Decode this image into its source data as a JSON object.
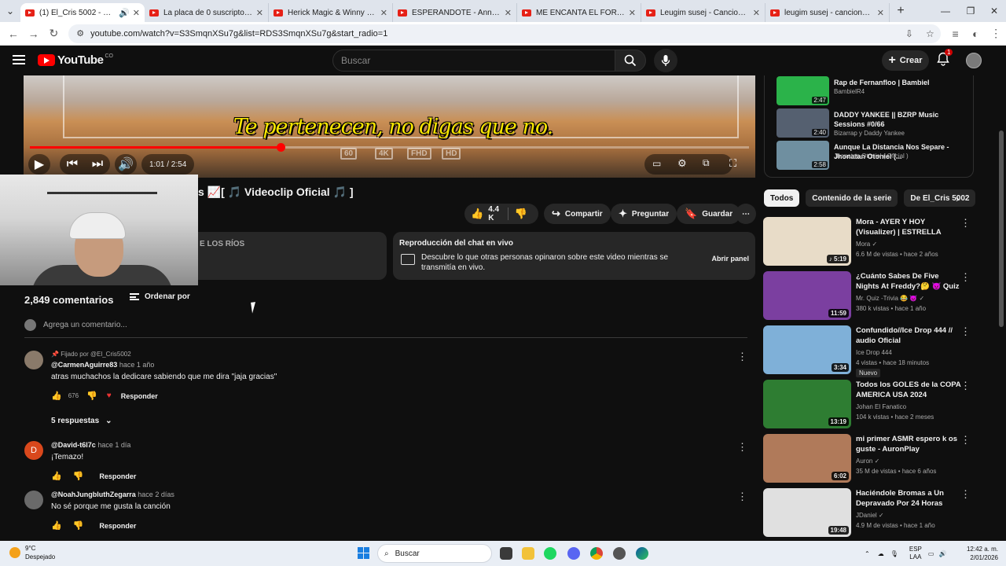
{
  "browser": {
    "tabs": [
      {
        "title": "(1) El_Cris 5002 - 📈 Me pu",
        "active": true,
        "audio": true
      },
      {
        "title": "La placa de 0 suscriptores / qu"
      },
      {
        "title": "Herick Magic & Winny Flow x E"
      },
      {
        "title": "ESPERÁNDOTE - Anna y lexa (V"
      },
      {
        "title": "ME ENCANTA EL FORTNITE (PA"
      },
      {
        "title": "Leugim susej - Cancion Cero V"
      },
      {
        "title": "leugim susej - canciones con 0"
      }
    ],
    "url": "youtube.com/watch?v=S3SmqnXSu7g&list=RDS3SmqnXSu7g&start_radio=1"
  },
  "header": {
    "logo_text": "YouTube",
    "country": "CO",
    "search_placeholder": "Buscar",
    "create_label": "Crear",
    "notifications": "1"
  },
  "player": {
    "subtitle": "Te pertenecen, no digas que no.",
    "time": "1:01 / 2:54",
    "progress": 0.349,
    "quality_badges": [
      "60",
      "4K",
      "FHD",
      "HD"
    ]
  },
  "video": {
    "title_partial": "s 📈[ 🎵 Videoclip Oficial 🎵 ]",
    "likes": "4.4 K",
    "share": "Compartir",
    "ask": "Preguntar",
    "save": "Guardar"
  },
  "description_fragment": "E LOS RÍOS",
  "chat_panel": {
    "heading": "Reproducción del chat en vivo",
    "text": "Descubre lo que otras personas opinaron sobre este video mientras se transmitía en vivo.",
    "button": "Abrir panel"
  },
  "comments": {
    "count": "2,849 comentarios",
    "sort": "Ordenar por",
    "add_placeholder": "Agrega un comentario...",
    "items": [
      {
        "pinned": "Fijado por @El_Cris5002",
        "author": "@CarmenAguirre83",
        "time": "hace 1 año",
        "text": "atras muchachos la dedicare sabiendo que me dira \"jaja gracias\"",
        "likes": "676",
        "reply": "Responder",
        "avatar_color": "#8a7a6a"
      },
      {
        "author": "@David-t6l7c",
        "time": "hace 1 día",
        "text": "¡Temazo!",
        "likes": "",
        "reply": "Responder",
        "avatar_color": "#d9481c",
        "initial": "D"
      },
      {
        "author": "@NoahJungbluthZegarra",
        "time": "hace 2 días",
        "text": "No sé porque me gusta la canción",
        "likes": "",
        "reply": "Responder",
        "avatar_color": "#6a6a6a"
      }
    ],
    "replies_label": "5 respuestas"
  },
  "mini_playlist": [
    {
      "title": "Rap de Fernanfloo | Bambiel",
      "channel": "BambielR4",
      "duration": "2:47",
      "color": "#2bb34a"
    },
    {
      "title": "DADDY YANKEE || BZRP Music Sessions #0/66",
      "channel": "Bizarrap y Daddy Yankee",
      "duration": "2:40",
      "color": "#556070"
    },
    {
      "title": "Aunque La Distancia Nos Separe - Jhonatan Otoniel (...",
      "channel": "Jhonatan Otoniel ( Oficial )",
      "duration": "2:58",
      "color": "#6f8fa0"
    }
  ],
  "chips": [
    "Todos",
    "Contenido de la serie",
    "De El_Cris 5002"
  ],
  "recommendations": [
    {
      "title": "Mora - AYER Y HOY (Visualizer) | ESTRELLA",
      "channel": "Mora ✓",
      "views": "6.6 M de vistas • hace 2 años",
      "duration": "♪ 5:19",
      "color": "#e8dcc8"
    },
    {
      "title": "¿Cuánto Sabes De Five Nights At Freddy?🤔 😈 Quiz FNAF 😂...",
      "channel": "Mr. Quiz -Trivia 😂 😈 ✓",
      "views": "380 k vistas • hace 1 año",
      "duration": "11:59",
      "color": "#7b3fa0"
    },
    {
      "title": "Confundido//Ice Drop 444 // audio Oficial",
      "channel": "Ice Drop 444",
      "views": "4 vistas • hace 18 minutos",
      "duration": "3:34",
      "color": "#7fb0d8",
      "badge": "Nuevo"
    },
    {
      "title": "Todos los GOLES de la COPA AMERICA USA 2024",
      "channel": "Johan El Fanatico",
      "views": "104 k vistas • hace 2 meses",
      "duration": "13:19",
      "color": "#2e7d32"
    },
    {
      "title": "mi primer ASMR espero k os guste - AuronPlay",
      "channel": "Auron ✓",
      "views": "35 M de vistas • hace 6 años",
      "duration": "6:02",
      "color": "#b07a5a"
    },
    {
      "title": "Haciéndole Bromas a Un Depravado Por 24 Horas",
      "channel": "JDaniel ✓",
      "views": "4.9 M de vistas • hace 1 año",
      "duration": "19:48",
      "color": "#e0e0e0"
    }
  ],
  "taskbar": {
    "temp": "9°C",
    "weather": "Despejado",
    "search": "Buscar",
    "lang_top": "ESP",
    "lang_bottom": "LAA",
    "time": "12:42 a. m.",
    "date": "2/01/2026"
  }
}
